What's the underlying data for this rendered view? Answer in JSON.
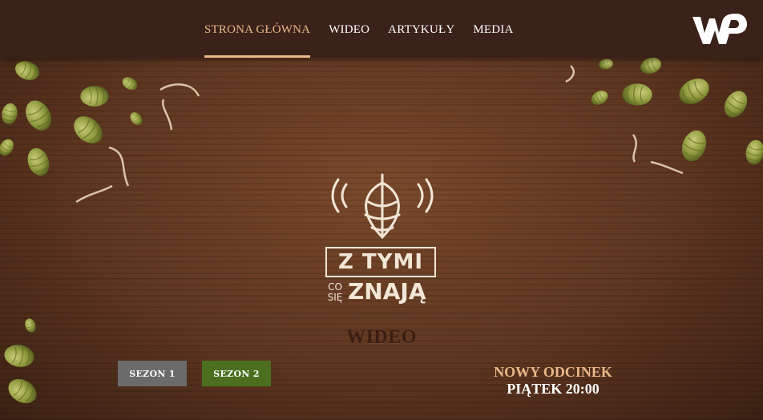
{
  "nav": {
    "items": [
      {
        "label": "STRONA GŁÓWNA",
        "active": true
      },
      {
        "label": "WIDEO",
        "active": false
      },
      {
        "label": "ARTYKUŁY",
        "active": false
      },
      {
        "label": "MEDIA",
        "active": false
      }
    ]
  },
  "brand": {
    "logo_text": "WP"
  },
  "show_logo": {
    "line1": "Z TYMI",
    "line2_small_top": "CO",
    "line2_small_bottom": "SIĘ",
    "line2_big": "ZNAJĄ"
  },
  "section": {
    "title": "WIDEO"
  },
  "seasons": [
    {
      "label": "SEZON 1",
      "color": "#6b6b6b"
    },
    {
      "label": "SEZON 2",
      "color": "#4b6f1f"
    }
  ],
  "next_episode": {
    "line1": "NOWY ODCINEK",
    "line2": "PIĄTEK 20:00"
  },
  "colors": {
    "accent": "#e9b889",
    "topbar": "#3a2119",
    "wood": "#5e3620"
  }
}
